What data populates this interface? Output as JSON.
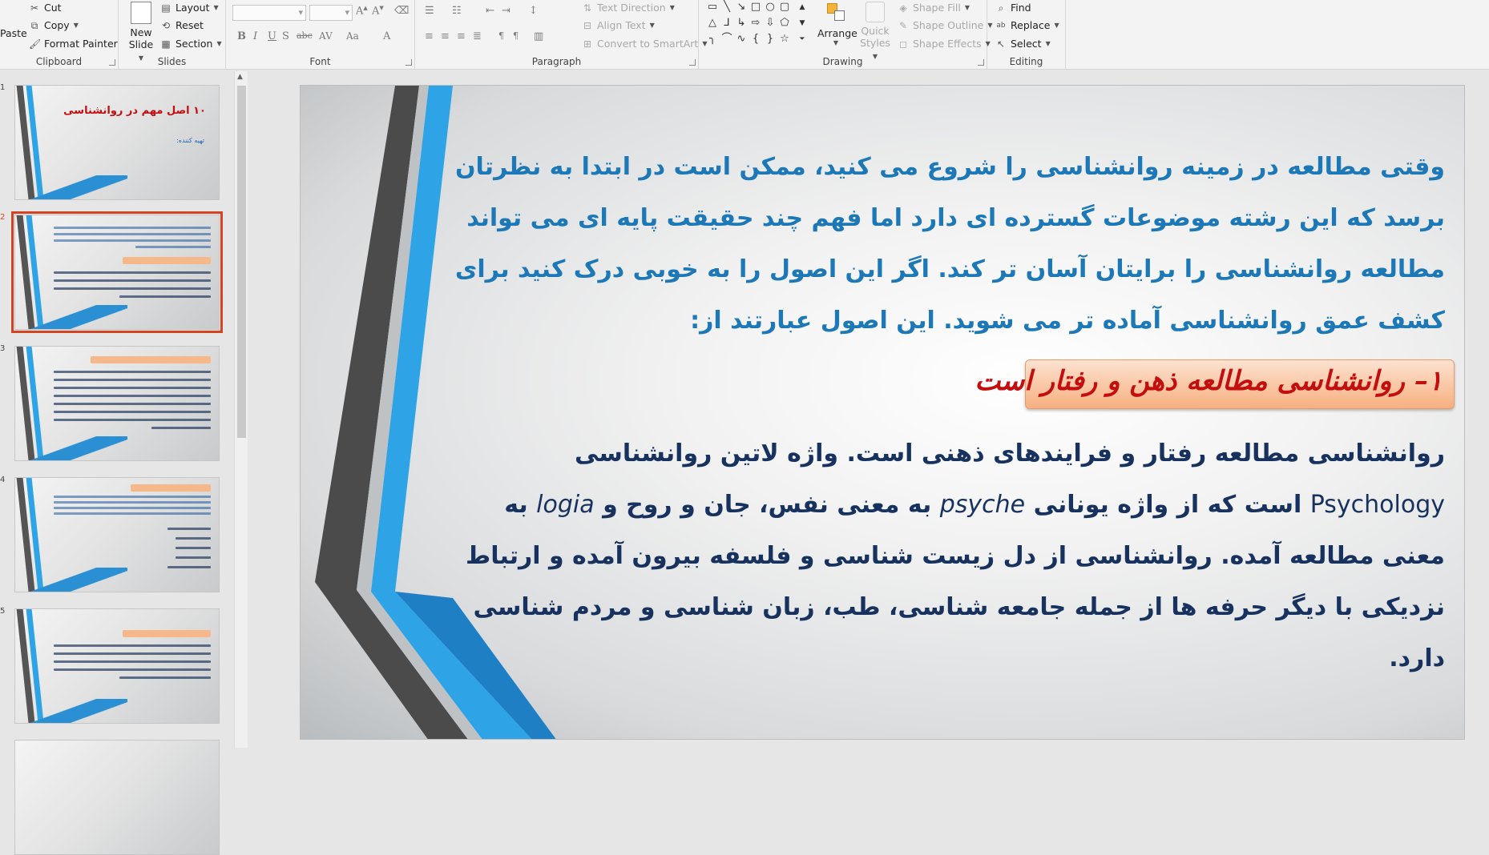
{
  "ribbon": {
    "clipboard": {
      "label": "Clipboard",
      "paste": "Paste",
      "cut": "Cut",
      "copy": "Copy",
      "format_painter": "Format Painter"
    },
    "slides": {
      "label": "Slides",
      "new_slide_line1": "New",
      "new_slide_line2": "Slide",
      "layout": "Layout",
      "reset": "Reset",
      "section": "Section"
    },
    "font": {
      "label": "Font"
    },
    "paragraph": {
      "label": "Paragraph",
      "text_direction": "Text Direction",
      "align_text": "Align Text",
      "convert_smartart": "Convert to SmartArt"
    },
    "drawing": {
      "label": "Drawing",
      "arrange": "Arrange",
      "quick_styles_line1": "Quick",
      "quick_styles_line2": "Styles",
      "shape_fill": "Shape Fill",
      "shape_outline": "Shape Outline",
      "shape_effects": "Shape Effects"
    },
    "editing": {
      "label": "Editing",
      "find": "Find",
      "replace": "Replace",
      "select": "Select"
    }
  },
  "thumbnails": {
    "slide1_title": "۱۰ اصل مهم در روانشناسی",
    "slide1_sub": "تهیه کننده:",
    "numbers": [
      "1",
      "2",
      "3",
      "4",
      "5"
    ]
  },
  "slide": {
    "intro": "وقتی مطالعه در زمینه روانشناسی را شروع می کنید، ممکن است در ابتدا به نظرتان برسد که این رشته موضوعات گسترده ای دارد اما فهم چند حقیقت پایه ای می تواند مطالعه روانشناسی را برایتان آسان تر کند. اگر این اصول را به خوبی درک کنید برای کشف عمق روانشناسی آماده تر می شوید. این اصول عبارتند از:",
    "heading": "۱– روانشناسی مطالعه ذهن و رفتار است",
    "body_part1": "روانشناسی مطالعه رفتار و فرایندهای ذهنی است. واژه لاتین روانشناسی",
    "body_psychology": "Psychology",
    "body_part2": "است که از واژه یونانی",
    "body_psyche": "psyche",
    "body_part3": "به معنی نفس، جان و روح و",
    "body_logia": "logia",
    "body_part4": "به معنی مطالعه آمده. روانشناسی از دل زیست شناسی و فلسفه بیرون آمده و ارتباط نزدیکی با دیگر حرفه ها از جمله جامعه شناسی، طب، زبان شناسی و مردم شناسی دارد."
  },
  "colors": {
    "intro_text": "#1d78b8",
    "heading_text": "#c40d0d",
    "body_text": "#17325e",
    "accent_blue": "#2ea3e6",
    "selection_border": "#d14424"
  }
}
